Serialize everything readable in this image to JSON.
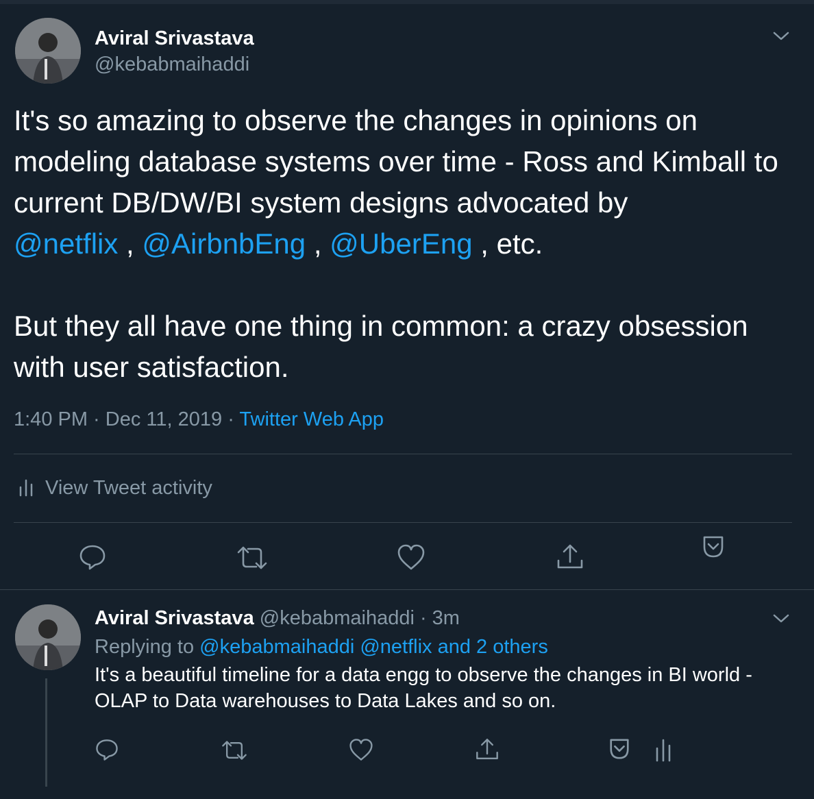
{
  "tweet": {
    "author_name": "Aviral Srivastava",
    "author_handle": "@kebabmaihaddi",
    "text_part1": "It's so amazing to observe the changes in opinions on modeling database systems over time - Ross and Kimball to current DB/DW/BI system designs advocated by\n",
    "mention1": "@netflix",
    "sep1": " , ",
    "mention2": "@AirbnbEng",
    "sep2": " , ",
    "mention3": "@UberEng",
    "text_part2": " , etc.\n\nBut they all have one thing in common: a crazy obsession with user satisfaction.",
    "time": "1:40 PM · Dec 11, 2019 · ",
    "source": "Twitter Web App",
    "activity_label": "View Tweet activity"
  },
  "reply": {
    "author_name": "Aviral Srivastava",
    "author_handle": "@kebabmaihaddi",
    "age": " · 3m",
    "replying_prefix": "Replying to ",
    "replying_to": "@kebabmaihaddi @netflix and 2 others",
    "text": "It's a beautiful timeline for a data engg to observe the changes in BI world - OLAP to Data warehouses to Data Lakes and so on."
  },
  "icons": [
    "chevron-down-icon",
    "analytics-icon",
    "reply-icon",
    "retweet-icon",
    "like-icon",
    "share-icon",
    "bookmark-icon"
  ],
  "colors": {
    "background": "#15202b",
    "link": "#1da1f2",
    "muted": "#8899a6",
    "divider": "#38444d"
  }
}
